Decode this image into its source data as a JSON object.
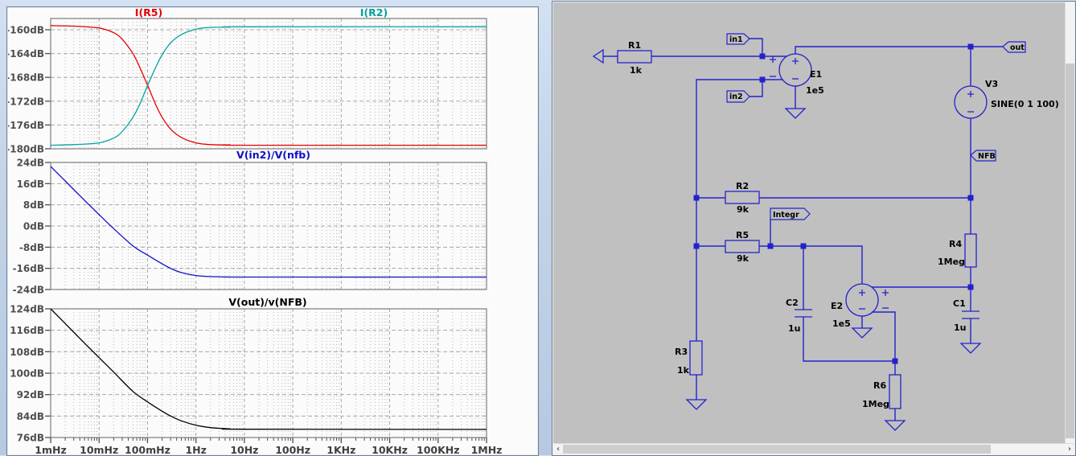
{
  "chart_data": {
    "type": "line",
    "x_axis": {
      "scale": "log",
      "unit": "Hz",
      "min": 0.001,
      "max": 1000000,
      "tick_values": [
        0.001,
        0.01,
        0.1,
        1,
        10,
        100,
        1000,
        10000,
        100000,
        1000000
      ],
      "tick_labels": [
        "1mHz",
        "10mHz",
        "100mHz",
        "1Hz",
        "10Hz",
        "100Hz",
        "1KHz",
        "10KHz",
        "100KHz",
        "1MHz"
      ]
    },
    "grid": true,
    "legend_position": "top-titles",
    "panes": [
      {
        "titles": [
          {
            "text": "I(R5)",
            "color": "#e60000"
          },
          {
            "text": "I(R2)",
            "color": "#00a2a2"
          }
        ],
        "y_unit": "dB",
        "ylim": [
          -180,
          -158.11
        ],
        "yticks": [
          {
            "v": -160,
            "label": "-160dB"
          },
          {
            "v": -164,
            "label": "-164dB"
          },
          {
            "v": -168,
            "label": "-168dB"
          },
          {
            "v": -172,
            "label": "-172dB"
          },
          {
            "v": -176,
            "label": "-176dB"
          },
          {
            "v": -180,
            "label": "-180dB"
          }
        ],
        "curves": [
          {
            "name": "I(R5)",
            "color": "#e60000",
            "points": [
              [
                0.001,
                -159.3
              ],
              [
                0.003,
                -159.4
              ],
              [
                0.01,
                -159.7
              ],
              [
                0.02,
                -160.5
              ],
              [
                0.03,
                -161.6
              ],
              [
                0.05,
                -164.0
              ],
              [
                0.07,
                -166.4
              ],
              [
                0.1,
                -169.3
              ],
              [
                0.15,
                -172.7
              ],
              [
                0.2,
                -174.7
              ],
              [
                0.3,
                -176.7
              ],
              [
                0.5,
                -178.1
              ],
              [
                1,
                -179.0
              ],
              [
                2,
                -179.3
              ],
              [
                5,
                -179.35
              ],
              [
                10,
                -179.4
              ],
              [
                1000000,
                -179.4
              ]
            ]
          },
          {
            "name": "I(R2)",
            "color": "#00a2a2",
            "points": [
              [
                0.001,
                -179.4
              ],
              [
                0.003,
                -179.3
              ],
              [
                0.01,
                -179.0
              ],
              [
                0.02,
                -178.2
              ],
              [
                0.03,
                -177.1
              ],
              [
                0.05,
                -174.7
              ],
              [
                0.07,
                -172.4
              ],
              [
                0.1,
                -169.4
              ],
              [
                0.15,
                -166.2
              ],
              [
                0.2,
                -164.2
              ],
              [
                0.3,
                -162.2
              ],
              [
                0.5,
                -160.8
              ],
              [
                1,
                -159.9
              ],
              [
                2,
                -159.6
              ],
              [
                5,
                -159.55
              ],
              [
                10,
                -159.5
              ],
              [
                1000000,
                -159.5
              ]
            ]
          }
        ]
      },
      {
        "titles": [
          {
            "text": "V(in2)/V(nfb)",
            "color": "#1010c8"
          }
        ],
        "y_unit": "dB",
        "ylim": [
          -24,
          24
        ],
        "yticks": [
          {
            "v": 24,
            "label": "24dB"
          },
          {
            "v": 16,
            "label": "16dB"
          },
          {
            "v": 8,
            "label": "8dB"
          },
          {
            "v": 0,
            "label": "0dB"
          },
          {
            "v": -8,
            "label": "-8dB"
          },
          {
            "v": -16,
            "label": "-16dB"
          },
          {
            "v": -24,
            "label": "-24dB"
          }
        ],
        "curves": [
          {
            "name": "V(in2)/V(nfb)",
            "color": "#1010c8",
            "points": [
              [
                0.001,
                22.5
              ],
              [
                0.002,
                17.0
              ],
              [
                0.005,
                9.7
              ],
              [
                0.01,
                4.3
              ],
              [
                0.02,
                -1.0
              ],
              [
                0.05,
                -7.5
              ],
              [
                0.1,
                -11.0
              ],
              [
                0.2,
                -14.3
              ],
              [
                0.3,
                -16.0
              ],
              [
                0.5,
                -17.6
              ],
              [
                1,
                -18.7
              ],
              [
                2,
                -19.1
              ],
              [
                5,
                -19.25
              ],
              [
                10,
                -19.3
              ],
              [
                1000000,
                -19.3
              ]
            ]
          }
        ]
      },
      {
        "titles": [
          {
            "text": "V(out)/v(NFB)",
            "color": "#000000"
          }
        ],
        "y_unit": "dB",
        "ylim": [
          76,
          124
        ],
        "yticks": [
          {
            "v": 124,
            "label": "124dB"
          },
          {
            "v": 116,
            "label": "116dB"
          },
          {
            "v": 108,
            "label": "108dB"
          },
          {
            "v": 100,
            "label": "100dB"
          },
          {
            "v": 92,
            "label": "92dB"
          },
          {
            "v": 84,
            "label": "84dB"
          },
          {
            "v": 76,
            "label": "76dB"
          }
        ],
        "curves": [
          {
            "name": "V(out)/v(NFB)",
            "color": "#000000",
            "points": [
              [
                0.001,
                124
              ],
              [
                0.002,
                118.5
              ],
              [
                0.005,
                111.2
              ],
              [
                0.01,
                105.8
              ],
              [
                0.02,
                100.4
              ],
              [
                0.05,
                93.2
              ],
              [
                0.1,
                89.3
              ],
              [
                0.2,
                85.8
              ],
              [
                0.3,
                84.0
              ],
              [
                0.5,
                82.2
              ],
              [
                1,
                80.6
              ],
              [
                2,
                79.7
              ],
              [
                5,
                79.2
              ],
              [
                10,
                79.1
              ],
              [
                1000000,
                79.0
              ]
            ]
          }
        ]
      }
    ]
  },
  "schematic": {
    "wire_color": "#2222cc",
    "background": "#c0c0c0",
    "components": {
      "R1": {
        "name": "R1",
        "value": "1k"
      },
      "R2": {
        "name": "R2",
        "value": "9k"
      },
      "R3": {
        "name": "R3",
        "value": "1k"
      },
      "R4": {
        "name": "R4",
        "value": "1Meg"
      },
      "R5": {
        "name": "R5",
        "value": "9k"
      },
      "R6": {
        "name": "R6",
        "value": "1Meg"
      },
      "C1": {
        "name": "C1",
        "value": "1u"
      },
      "C2": {
        "name": "C2",
        "value": "1u"
      },
      "E1": {
        "name": "E1",
        "value": "1e5"
      },
      "E2": {
        "name": "E2",
        "value": "1e5"
      },
      "V3": {
        "name": "V3",
        "value": "SINE(0 1 100)"
      }
    },
    "net_labels": {
      "in1": "in1",
      "in2": "in2",
      "out": "out",
      "nfb": "NFB",
      "integr": "Integr"
    }
  }
}
